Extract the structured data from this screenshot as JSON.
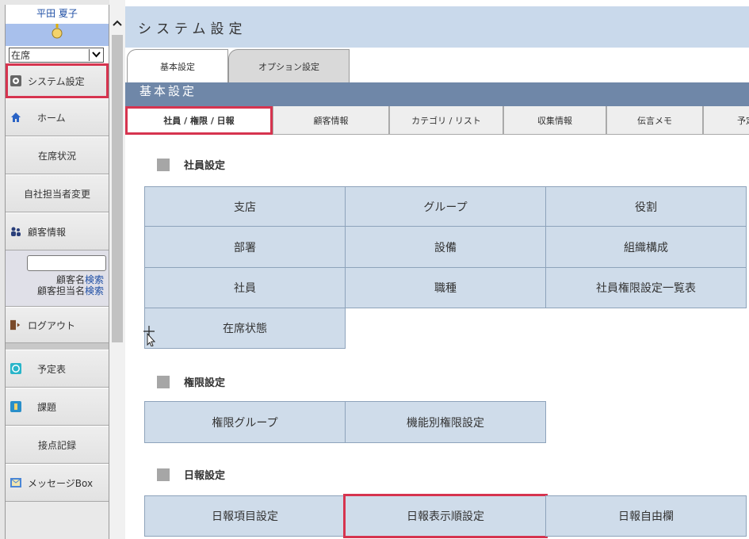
{
  "sidebar": {
    "user_name": "平田 夏子",
    "status_value": "在席",
    "items": {
      "system_settings": "システム設定",
      "home": "ホーム",
      "attendance": "在席状況",
      "change_rep": "自社担当者変更",
      "customer_info": "顧客情報",
      "logout": "ログアウト",
      "schedule": "予定表",
      "tasks": "課題",
      "contact_log": "接点記録",
      "message_box": "メッセージBox"
    },
    "search": {
      "name_label": "顧客名",
      "rep_label": "顧客担当名",
      "search_link": "検索"
    }
  },
  "header": {
    "title": "システム設定"
  },
  "tabs_top": {
    "basic": "基本設定",
    "option": "オプション設定"
  },
  "section_title": "基本設定",
  "tabs_second": [
    "社員 / 権限 / 日報",
    "顧客情報",
    "カテゴリ / リスト",
    "収集情報",
    "伝言メモ",
    "予定"
  ],
  "employee_settings": {
    "title": "社員設定",
    "cells": [
      "支店",
      "グループ",
      "役割",
      "部署",
      "設備",
      "組織構成",
      "社員",
      "職種",
      "社員権限設定一覧表",
      "在席状態"
    ]
  },
  "permission_settings": {
    "title": "権限設定",
    "cells": [
      "権限グループ",
      "機能別権限設定"
    ]
  },
  "report_settings": {
    "title": "日報設定",
    "cells": [
      "日報項目設定",
      "日報表示順設定",
      "日報自由欄"
    ]
  },
  "colors": {
    "highlight": "#d6344f",
    "header_bg": "#c9d9eb",
    "section_bg": "#6f87a8",
    "cell_bg": "#cfdcea"
  }
}
